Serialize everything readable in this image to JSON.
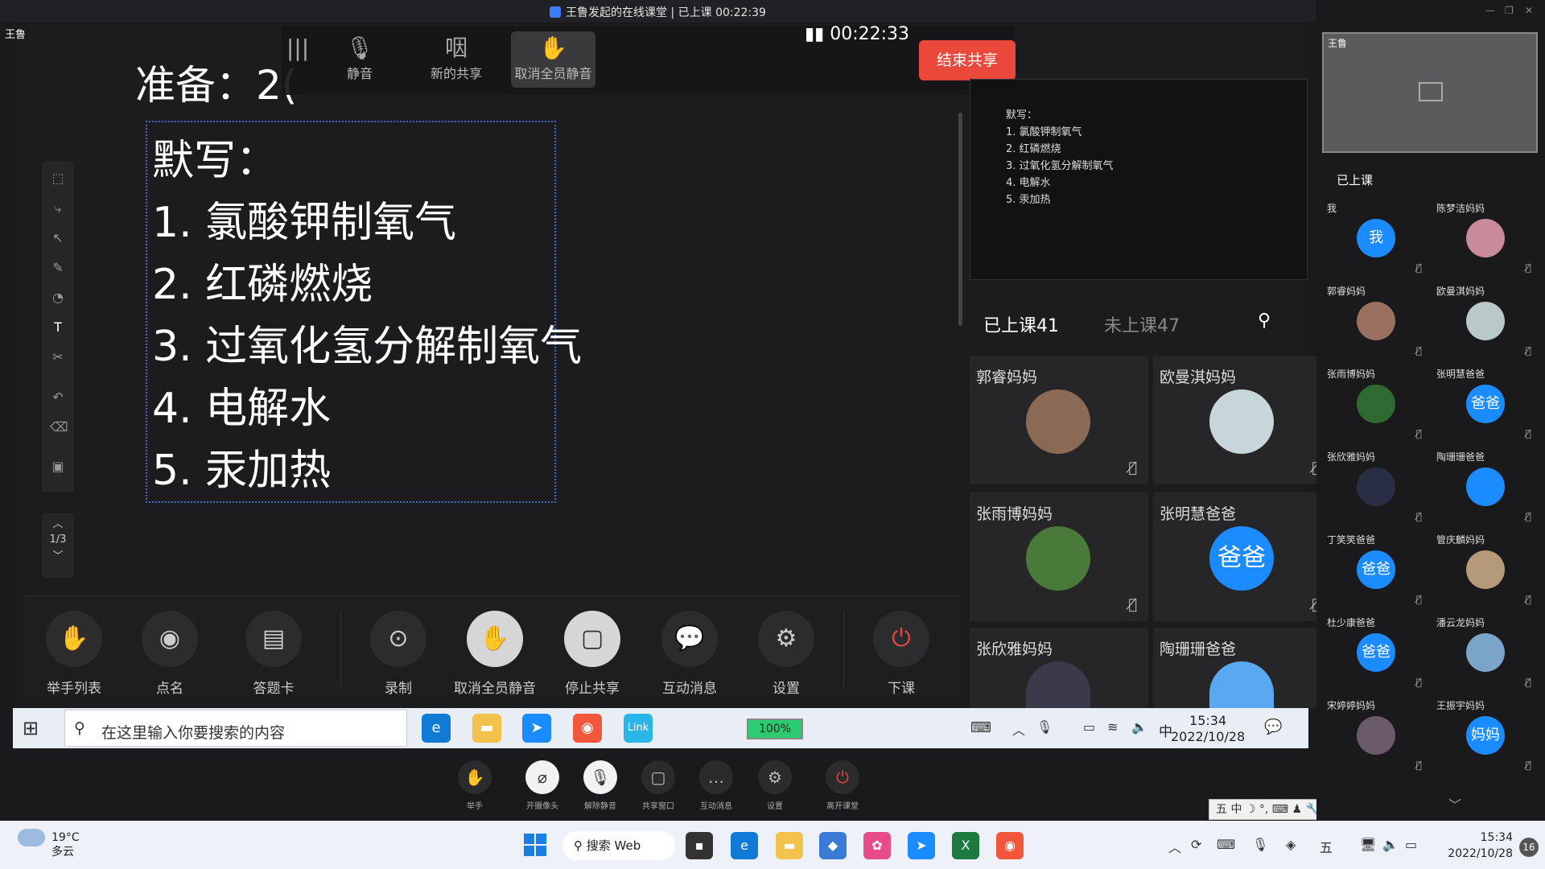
{
  "window": {
    "title": "王鲁发起的在线课堂 | 已上课 00:22:39",
    "owner": "王鲁"
  },
  "share_toolbar": {
    "mute_label": "静音",
    "new_share_label": "新的共享",
    "unmute_all_label": "取消全员静音",
    "timer": "00:22:33",
    "end_share_label": "结束共享",
    "mute_icon": "microphone-icon",
    "new_share_icon": "share-icon"
  },
  "slide": {
    "heading_partial": "准备：2(",
    "textbox_lines": [
      "默写：",
      "1. 氯酸钾制氧气",
      "2. 红磷燃烧",
      "3. 过氧化氢分解制氧气",
      "4. 电解水",
      "5. 汞加热"
    ],
    "pager": "1/3"
  },
  "class_toolbar": {
    "items": [
      {
        "label": "举手列表",
        "icon": "hand-icon"
      },
      {
        "label": "点名",
        "icon": "rollcall-icon"
      },
      {
        "label": "答题卡",
        "icon": "answer-card-icon"
      },
      {
        "label": "录制",
        "icon": "record-icon"
      },
      {
        "label": "取消全员静音",
        "icon": "unmute-all-icon"
      },
      {
        "label": "停止共享",
        "icon": "stop-share-icon"
      },
      {
        "label": "互动消息",
        "icon": "chat-icon"
      },
      {
        "label": "设置",
        "icon": "gear-icon"
      },
      {
        "label": "下课",
        "icon": "power-icon"
      }
    ]
  },
  "preview": {
    "lines": [
      "默写：",
      "1. 氯酸钾制氧气",
      "2. 红磷燃烧",
      "3. 过氧化氢分解制氧气",
      "4. 电解水",
      "5. 汞加热"
    ]
  },
  "member_tabs": {
    "attending": "已上课41",
    "absent": "未上课47"
  },
  "member_tiles": [
    {
      "name": "郭睿妈妈",
      "avatar": ""
    },
    {
      "name": "欧曼淇妈妈",
      "avatar": ""
    },
    {
      "name": "张雨博妈妈",
      "avatar": ""
    },
    {
      "name": "张明慧爸爸",
      "avatar": "爸爸"
    },
    {
      "name": "张欣雅妈妈",
      "avatar": ""
    },
    {
      "name": "陶珊珊爸爸",
      "avatar": ""
    }
  ],
  "inner_taskbar": {
    "search_placeholder": "在这里输入你要搜索的内容",
    "battery": "100%",
    "battery_level": 1.0,
    "ime": "中",
    "time": "15:34",
    "date": "2022/10/28",
    "link_label": "Link"
  },
  "meeting_bar": {
    "items": [
      {
        "label": "举手",
        "icon": "hand-icon"
      },
      {
        "label": "开摄像头",
        "icon": "camera-off-icon"
      },
      {
        "label": "解除静音",
        "icon": "mic-off-icon"
      },
      {
        "label": "共享窗口",
        "icon": "share-window-icon"
      },
      {
        "label": "互动消息",
        "icon": "chat-icon"
      },
      {
        "label": "设置",
        "icon": "gear-icon"
      },
      {
        "label": "离开课堂",
        "icon": "power-icon"
      }
    ]
  },
  "ime_bar": {
    "text": "五 中 ☽ °, ⌨ ♟ 🔧"
  },
  "right_panel": {
    "self_name": "王鲁",
    "status": "已上课",
    "tiles": [
      {
        "name": "我",
        "avatar": "我"
      },
      {
        "name": "陈梦洁妈妈",
        "avatar": ""
      },
      {
        "name": "郭睿妈妈",
        "avatar": ""
      },
      {
        "name": "欧曼淇妈妈",
        "avatar": ""
      },
      {
        "name": "张雨博妈妈",
        "avatar": ""
      },
      {
        "name": "张明慧爸爸",
        "avatar": "爸爸"
      },
      {
        "name": "张欣雅妈妈",
        "avatar": ""
      },
      {
        "name": "陶珊珊爸爸",
        "avatar": ""
      },
      {
        "name": "丁笑笑爸爸",
        "avatar": "爸爸"
      },
      {
        "name": "管庆麟妈妈",
        "avatar": ""
      },
      {
        "name": "杜少康爸爸",
        "avatar": "爸爸"
      },
      {
        "name": "潘云龙妈妈",
        "avatar": ""
      },
      {
        "name": "宋婷婷妈妈",
        "avatar": ""
      },
      {
        "name": "王振宇妈妈",
        "avatar": "妈妈"
      }
    ]
  },
  "outer_taskbar": {
    "weather_temp": "19°C",
    "weather_desc": "多云",
    "search_label": "搜索 Web",
    "time": "15:34",
    "date": "2022/10/28",
    "notifications": "16"
  },
  "colors": {
    "accent": "#1a8cff",
    "danger": "#e9483b"
  }
}
